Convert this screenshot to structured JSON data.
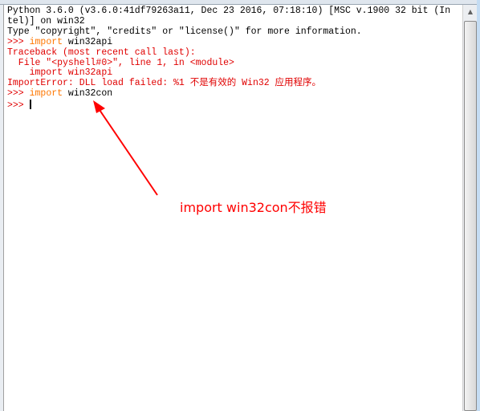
{
  "shell": {
    "lines": [
      {
        "text": "Python 3.6.0 (v3.6.0:41df79263a11, Dec 23 2016, 07:18:10) [MSC v.1900 32 bit (In"
      },
      {
        "text": "tel)] on win32"
      },
      {
        "text": "Type \"copyright\", \"credits\" or \"license()\" for more information."
      }
    ],
    "prompt": ">>> ",
    "cmd1_kw": "import",
    "cmd1_rest": " win32api",
    "tb1": "Traceback (most recent call last):",
    "tb2": "  File \"<pyshell#0>\", line 1, in <module>",
    "tb3": "    import win32api",
    "tb4": "ImportError: DLL load failed: %1 不是有效的 Win32 应用程序。",
    "cmd2_kw": "import",
    "cmd2_rest": " win32con"
  },
  "annotation": {
    "text": "import win32con不报错",
    "color": "#ff0000"
  },
  "scrollbar": {
    "up_icon": "▲"
  }
}
